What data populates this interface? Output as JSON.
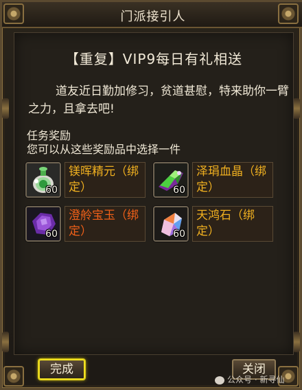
{
  "window": {
    "title": "门派接引人"
  },
  "quest": {
    "headline": "【重复】VIP9每日有礼相送",
    "intro": "道友近日勤加修习，贫道甚慰，特来助你一臂之力，且拿去吧!",
    "reward_title": "任务奖励",
    "reward_subtitle": "您可以从这些奖励品中选择一件"
  },
  "rewards": [
    {
      "name": "镁晖精元（绑定）",
      "count": "60",
      "name_color": "#f0b020",
      "icon": "green-potion-icon"
    },
    {
      "name": "泽琄血晶（绑定）",
      "count": "60",
      "name_color": "#f0b020",
      "icon": "green-crystal-icon"
    },
    {
      "name": "澄舲宝玉（绑定）",
      "count": "60",
      "name_color": "#f06018",
      "icon": "purple-gem-icon"
    },
    {
      "name": "天鸿石（绑定）",
      "count": "60",
      "name_color": "#f0b020",
      "icon": "prism-stone-icon"
    }
  ],
  "buttons": {
    "done": "完成",
    "close": "关闭"
  },
  "watermark": "公众号 · 新寻仙"
}
